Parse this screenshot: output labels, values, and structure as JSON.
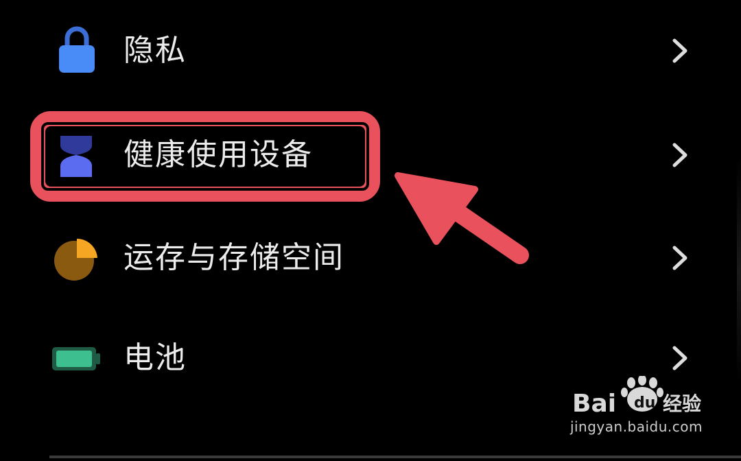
{
  "settings": {
    "items": [
      {
        "label": "隐私",
        "icon": "lock-icon",
        "icon_color": "#4a8cf7"
      },
      {
        "label": "健康使用设备",
        "icon": "hourglass-icon",
        "icon_color": "#5b6cf0"
      },
      {
        "label": "运存与存储空间",
        "icon": "pie-storage-icon",
        "icon_color": "#f5a623"
      },
      {
        "label": "电池",
        "icon": "battery-icon",
        "icon_color": "#3dbf90"
      }
    ],
    "highlighted_index": 1
  },
  "annotation": {
    "highlight_color": "#e9525d"
  },
  "watermark": {
    "brand": "Bai经验",
    "url": "jingyan.baidu.com"
  }
}
